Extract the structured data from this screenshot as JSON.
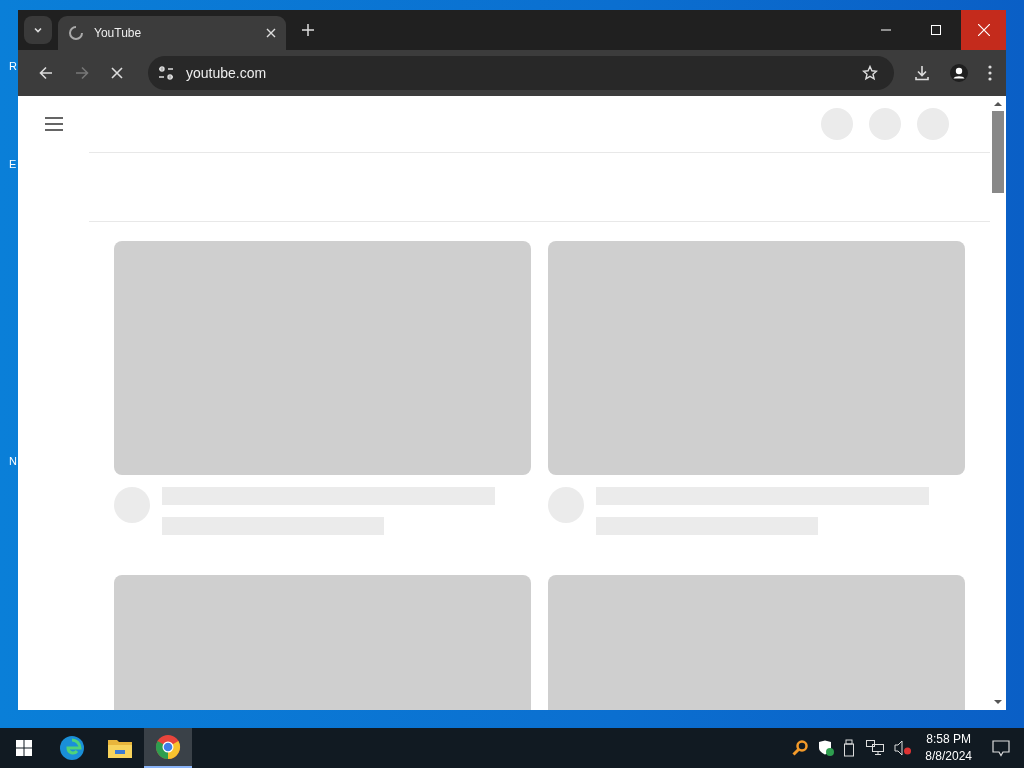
{
  "desktop": {
    "icon_labels": [
      "R",
      "E",
      "N"
    ]
  },
  "browser": {
    "tab": {
      "title": "YouTube",
      "loading": true
    },
    "toolbar": {
      "forward": {
        "disabled": true
      },
      "loading": true,
      "address": "youtube.com"
    }
  },
  "taskbar": {
    "apps": [
      {
        "kind": "edge",
        "selected": false
      },
      {
        "kind": "explorer",
        "selected": false
      },
      {
        "kind": "chrome",
        "selected": true
      }
    ],
    "time": "8:58 PM",
    "date": "8/8/2024"
  }
}
